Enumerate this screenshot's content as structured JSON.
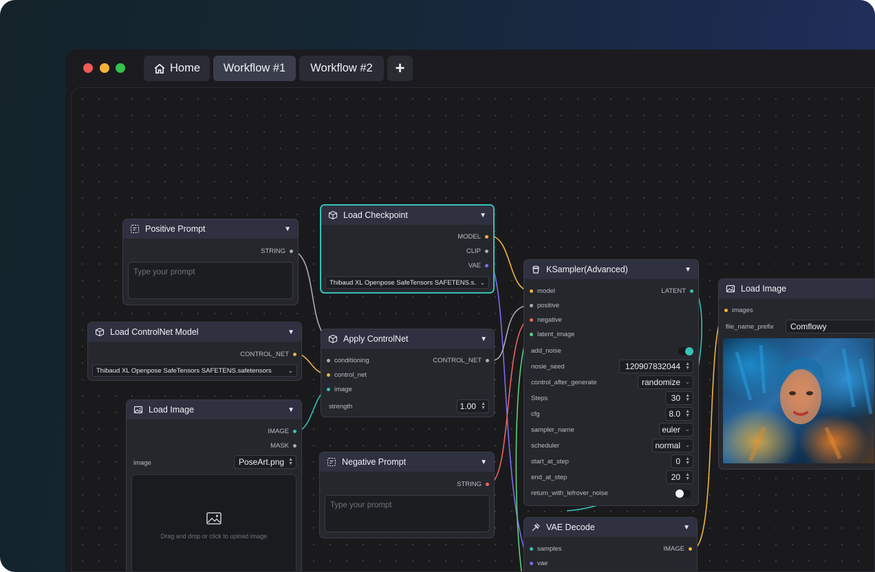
{
  "window": {
    "tabs": [
      {
        "label": "Home",
        "icon": "home-icon"
      },
      {
        "label": "Workflow #1",
        "active": true
      },
      {
        "label": "Workflow #2"
      }
    ],
    "new_tab_label": "+"
  },
  "nodes": {
    "positive_prompt": {
      "title": "Positive Prompt",
      "output": "STRING",
      "placeholder": "Type your prompt"
    },
    "load_checkpoint": {
      "title": "Load Checkpoint",
      "outputs": [
        "MODEL",
        "CLIP",
        "VAE"
      ],
      "model_value": "Thibaud XL Openpose SafeTensors SAFETENS.s..."
    },
    "load_controlnet": {
      "title": "Load ControlNet Model",
      "output": "CONTROL_NET",
      "model_value": "Thibaud XL Openpose SafeTensors SAFETENS.safetensors"
    },
    "apply_controlnet": {
      "title": "Apply ControlNet",
      "inputs": [
        "conditioning",
        "control_net",
        "image"
      ],
      "output": "CONTROL_NET",
      "strength_label": "strength",
      "strength_value": "1.00"
    },
    "load_image_left": {
      "title": "Load Image",
      "outputs": [
        "IMAGE",
        "MASK"
      ],
      "image_label": "image",
      "image_value": "PoseArt.png",
      "drop_text": "Drag and drop or click to upload image"
    },
    "negative_prompt": {
      "title": "Negative Prompt",
      "output": "STRING",
      "placeholder": "Type your prompt"
    },
    "ksampler": {
      "title": "KSampler(Advanced)",
      "inputs": [
        "model",
        "positive",
        "negative",
        "latent_image"
      ],
      "output": "LATENT",
      "add_noise_label": "add_noise",
      "add_noise_on": true,
      "params": [
        {
          "label": "nosie_seed",
          "value": "120907832044",
          "kind": "number"
        },
        {
          "label": "control_after_generate",
          "value": "randomize",
          "kind": "select"
        },
        {
          "label": "Steps",
          "value": "30",
          "kind": "number"
        },
        {
          "label": "cfg",
          "value": "8.0",
          "kind": "number"
        },
        {
          "label": "sampler_name",
          "value": "euler",
          "kind": "select"
        },
        {
          "label": "scheduler",
          "value": "normal",
          "kind": "select"
        },
        {
          "label": "start_at_step",
          "value": "0",
          "kind": "number"
        },
        {
          "label": "end_at_step",
          "value": "20",
          "kind": "number"
        }
      ],
      "return_noise_label": "return_with_lefrover_noise",
      "return_noise_on": false
    },
    "vae_decode": {
      "title": "VAE Decode",
      "inputs": [
        "samples",
        "vae"
      ],
      "output": "IMAGE"
    },
    "load_image_right": {
      "title": "Load Image",
      "input": "images",
      "prefix_label": "file_name_prefix",
      "prefix_value": "Comflowy"
    }
  },
  "colors": {
    "model": "#f2b33d",
    "clip": "#a9acb6",
    "vae": "#7a6cf0",
    "control_net": "#e8b24a",
    "image": "#36c3b6",
    "string": "#a9acb6",
    "negative": "#ef6461",
    "latent": "#36c3b6",
    "accent": "#36c3b6"
  }
}
